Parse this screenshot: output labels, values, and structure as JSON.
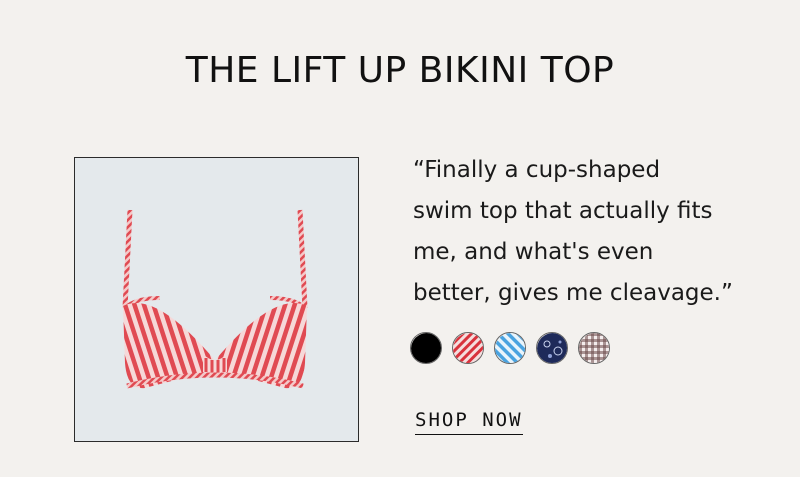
{
  "header": {
    "title": "THE LIFT UP BIKINI TOP"
  },
  "product": {
    "image_icon": "striped-bikini-top-icon"
  },
  "quote": {
    "lines": [
      "“Finally a cup-shaped",
      "swim top that actually fits",
      "me, and what's even",
      "better, gives me cleavage.”"
    ]
  },
  "swatches": [
    {
      "name": "black",
      "color": "#000000"
    },
    {
      "name": "red-stripe",
      "color": "#d8323c"
    },
    {
      "name": "blue-stripe",
      "color": "#4aa3e0"
    },
    {
      "name": "navy-paisley",
      "color": "#1e2a5a"
    },
    {
      "name": "gingham",
      "color": "#6b4a4a"
    }
  ],
  "cta": {
    "label": "SHOP NOW"
  }
}
